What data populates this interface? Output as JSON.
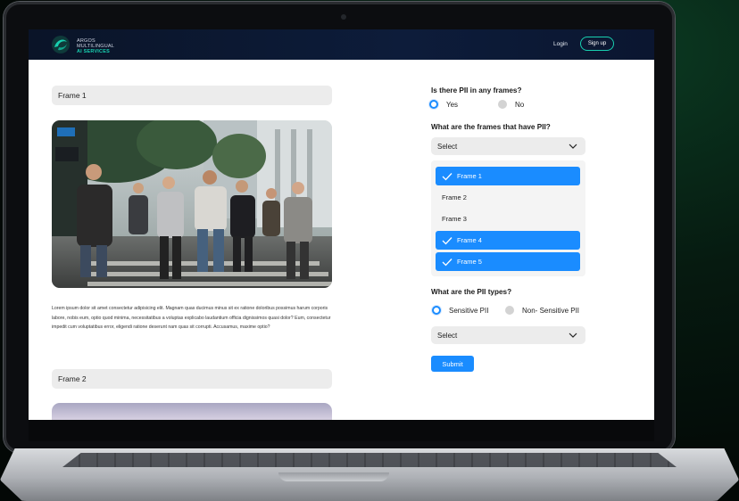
{
  "brand": {
    "line1": "ARGOS",
    "line2": "MULTILINGUAL",
    "line3": "AI SERVICES"
  },
  "nav": {
    "login": "Login",
    "signup": "Sign up"
  },
  "frames": [
    {
      "label": "Frame 1"
    },
    {
      "label": "Frame 2"
    }
  ],
  "paragraph": "Lorem ipsum dolor sit amet consectetur adipisicing elit. Magnam quas ducimus minus sit ex ratione doloribus possimus harum corporis labore, nobis eum, optio quod minima, necessitatibus a voluptas explicabo laudantium officia dignissimos quasi dolor? Eum, consectetur impedit cum voluptatibus error, eligendi ratione deserunt nam quas sit corrupti. Accusamus, maxime optio?",
  "form": {
    "q_pii": "Is there PII in any frames?",
    "pii_options": [
      "Yes",
      "No"
    ],
    "q_frames": "What are the frames that have PII?",
    "frames_select": "Select",
    "frame_options": [
      {
        "label": "Frame 1",
        "selected": true
      },
      {
        "label": "Frame 2",
        "selected": false
      },
      {
        "label": "Frame 3",
        "selected": false
      },
      {
        "label": "Frame 4",
        "selected": true
      },
      {
        "label": "Frame 5",
        "selected": true
      }
    ],
    "q_types": "What are the PII types?",
    "type_options": [
      "Sensitive PII",
      "Non- Sensitive PII"
    ],
    "types_select": "Select",
    "submit": "Submit"
  },
  "colors": {
    "accent": "#1a8cff",
    "brand_teal": "#18d0b0",
    "nav_bg": "#0b1630"
  }
}
